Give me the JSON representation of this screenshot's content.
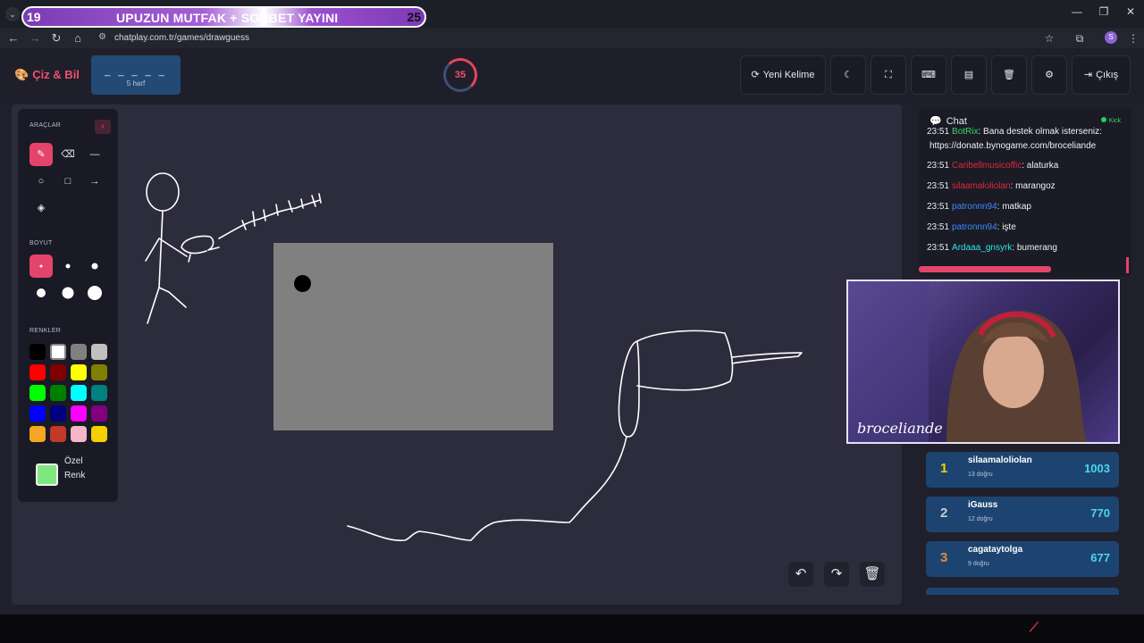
{
  "browser": {
    "stream_tab": {
      "left_number": "19",
      "title": "UPUZUN MUTFAK + SOHBET YAYINI",
      "right_number": "25"
    },
    "url": "chatplay.com.tr/games/drawguess",
    "profile_initial": "S"
  },
  "app": {
    "logo": "Çiz & Bil",
    "word": {
      "blanks": "_ _ _ _ _",
      "letters": "5 harf"
    },
    "timer": "35",
    "nav": {
      "new_word": "Yeni Kelime",
      "exit": "Çıkış"
    }
  },
  "tools": {
    "tools_title": "ARAÇLAR",
    "size_title": "BOYUT",
    "colors_title": "RENKLER",
    "custom_color_line1": "Özel",
    "custom_color_line2": "Renk",
    "custom_color_value": "#7ee87e",
    "swatches": [
      "#000000",
      "#ffffff",
      "#808080",
      "#c0c0c0",
      "#ff0000",
      "#800000",
      "#ffff00",
      "#808000",
      "#00ff00",
      "#008000",
      "#00ffff",
      "#008080",
      "#0000ff",
      "#000080",
      "#ff00ff",
      "#800080",
      "#f5a623",
      "#c0392b",
      "#f5b7c5",
      "#f5d000"
    ]
  },
  "chat": {
    "title": "Chat",
    "platform": "Kick",
    "messages": [
      {
        "time": "23:51",
        "user": "BotRix",
        "user_color": "#3cd66a",
        "text": ": Bana destek olmak isterseniz:"
      },
      {
        "time": "",
        "user": "",
        "user_color": "#ffffff",
        "text": "https://donate.bynogame.com/broceliande"
      },
      {
        "time": "23:51",
        "user": "Caribellmusicoffic",
        "user_color": "#e3273d",
        "text": ": alaturka"
      },
      {
        "time": "23:51",
        "user": "silaamaloliolan",
        "user_color": "#e3273d",
        "text": ": marangoz"
      },
      {
        "time": "23:51",
        "user": "patronnn94",
        "user_color": "#3d8bff",
        "text": ": matkap"
      },
      {
        "time": "23:51",
        "user": "patronnn94",
        "user_color": "#3d8bff",
        "text": ": işte"
      },
      {
        "time": "23:51",
        "user": "Ardaaa_gnsyrk",
        "user_color": "#2ee6e6",
        "text": ": bumerang"
      }
    ],
    "progress": 0.62
  },
  "webcam": {
    "label": "broceliande"
  },
  "leaderboard": [
    {
      "rank": "1",
      "rank_color": "#f5d000",
      "name": "silaamaloliolan",
      "correct": "13 doğru",
      "score": "1003"
    },
    {
      "rank": "2",
      "rank_color": "#c9ccd6",
      "name": "iGauss",
      "correct": "12 doğru",
      "score": "770"
    },
    {
      "rank": "3",
      "rank_color": "#e8893a",
      "name": "cagataytolga",
      "correct": "9 doğru",
      "score": "677"
    }
  ]
}
